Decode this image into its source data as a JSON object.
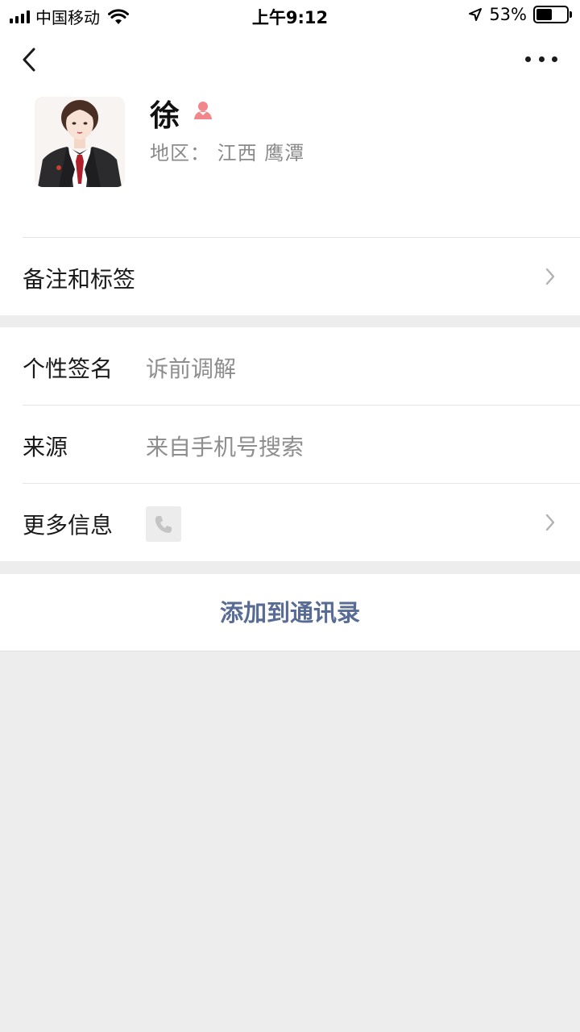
{
  "status_bar": {
    "carrier": "中国移动",
    "time": "上午9:12",
    "battery_percent": "53%",
    "battery_level": 0.53
  },
  "profile": {
    "name": "徐",
    "gender_icon": "female-icon",
    "gender_color": "#fa5151",
    "region": "地区：  江西 鹰潭"
  },
  "remarks_row": {
    "label": "备注和标签"
  },
  "info": {
    "signature_label": "个性签名",
    "signature_value": "诉前调解",
    "source_label": "来源",
    "source_value": "来自手机号搜索",
    "more_label": "更多信息",
    "more_icon": "phone-icon"
  },
  "actions": {
    "add_contact": "添加到通讯录"
  },
  "colors": {
    "link": "#576b95",
    "background": "#ededed"
  }
}
